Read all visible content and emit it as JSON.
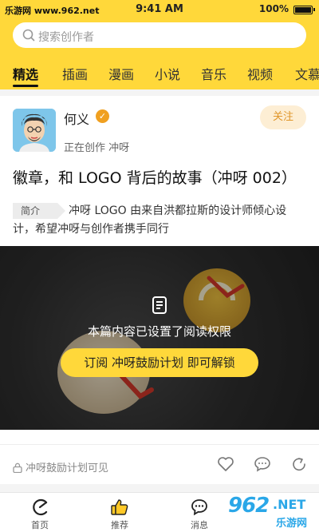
{
  "status_bar": {
    "watermark": "乐游网 www.962.net",
    "time": "9:41 AM",
    "battery": "100%"
  },
  "search": {
    "placeholder": "搜索创作者"
  },
  "tabs": [
    {
      "label": "精选",
      "active": true
    },
    {
      "label": "插画",
      "active": false
    },
    {
      "label": "漫画",
      "active": false
    },
    {
      "label": "小说",
      "active": false
    },
    {
      "label": "音乐",
      "active": false
    },
    {
      "label": "视频",
      "active": false
    },
    {
      "label": "文慕",
      "active": false
    }
  ],
  "post": {
    "author_name": "何义",
    "author_status": "正在创作 冲呀",
    "follow_label": "关注",
    "title": "徽章，和 LOGO 背后的故事（冲呀 002）",
    "intro_tag": "简介",
    "intro_text": "冲呀 LOGO 由来自洪都拉斯的设计师倾心设计，希望冲呀与创作者携手同行",
    "lock_text": "本篇内容已设置了阅读权限",
    "unlock_label": "订阅 冲呀鼓励计划 即可解锁",
    "visibility_text": "冲呀鼓励计划可见",
    "actions": [
      "heart-icon",
      "comment-icon",
      "share-icon"
    ]
  },
  "bottom_nav": [
    {
      "label": "首页",
      "icon": "home-icon"
    },
    {
      "label": "推荐",
      "icon": "thumb-up-icon"
    },
    {
      "label": "消息",
      "icon": "message-icon"
    }
  ],
  "watermark_bottom": {
    "number": "962",
    "suffix": ".NET",
    "cn": "乐游网"
  },
  "colors": {
    "brand_yellow": "#ffd83a",
    "follow_bg": "#fdeed4",
    "follow_text": "#e0962a",
    "watermark_blue": "#2aa7e8"
  }
}
